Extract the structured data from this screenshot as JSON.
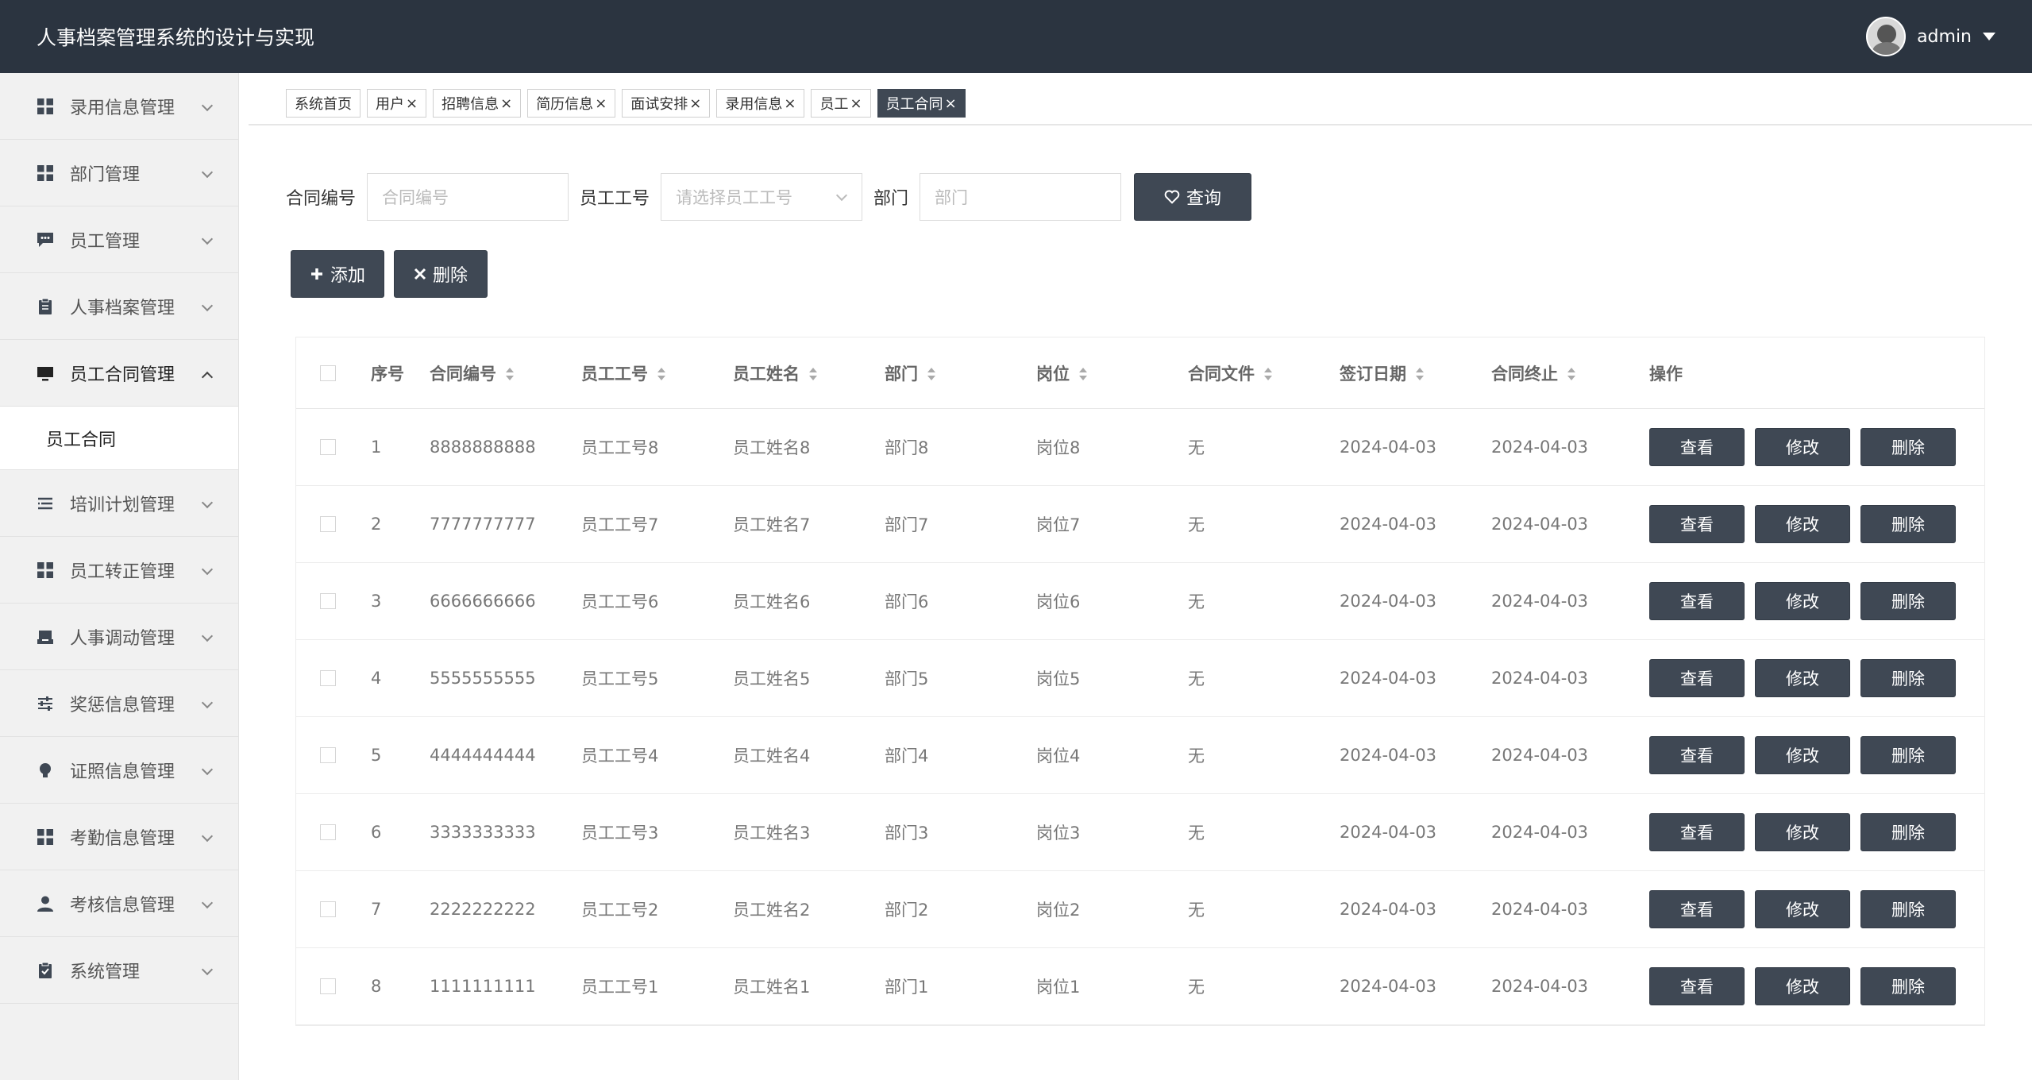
{
  "header": {
    "title": "人事档案管理系统的设计与实现",
    "username": "admin"
  },
  "sidebar": {
    "items": [
      {
        "label": "录用信息管理",
        "icon": "grid-icon"
      },
      {
        "label": "部门管理",
        "icon": "grid-icon"
      },
      {
        "label": "员工管理",
        "icon": "chat-icon"
      },
      {
        "label": "人事档案管理",
        "icon": "clipboard-icon"
      },
      {
        "label": "员工合同管理",
        "icon": "monitor-icon",
        "open": true,
        "children": [
          "员工合同"
        ]
      },
      {
        "label": "培训计划管理",
        "icon": "list-icon"
      },
      {
        "label": "员工转正管理",
        "icon": "grid-icon"
      },
      {
        "label": "人事调动管理",
        "icon": "inbox-icon"
      },
      {
        "label": "奖惩信息管理",
        "icon": "sliders-icon"
      },
      {
        "label": "证照信息管理",
        "icon": "bulb-icon"
      },
      {
        "label": "考勤信息管理",
        "icon": "grid-icon"
      },
      {
        "label": "考核信息管理",
        "icon": "user-icon"
      },
      {
        "label": "系统管理",
        "icon": "clipboard-check-icon"
      }
    ]
  },
  "tabs": [
    {
      "label": "系统首页",
      "closable": false
    },
    {
      "label": "用户",
      "closable": true
    },
    {
      "label": "招聘信息",
      "closable": true
    },
    {
      "label": "简历信息",
      "closable": true
    },
    {
      "label": "面试安排",
      "closable": true
    },
    {
      "label": "录用信息",
      "closable": true
    },
    {
      "label": "员工",
      "closable": true
    },
    {
      "label": "员工合同",
      "closable": true,
      "active": true
    }
  ],
  "search": {
    "contract_no_label": "合同编号",
    "contract_no_placeholder": "合同编号",
    "emp_no_label": "员工工号",
    "emp_no_placeholder": "请选择员工工号",
    "dept_label": "部门",
    "dept_placeholder": "部门",
    "query_button": "查询"
  },
  "actions": {
    "add": "添加",
    "delete": "删除"
  },
  "table": {
    "headers": {
      "index": "序号",
      "contract_no": "合同编号",
      "emp_no": "员工工号",
      "emp_name": "员工姓名",
      "dept": "部门",
      "position": "岗位",
      "file": "合同文件",
      "sign_date": "签订日期",
      "end_date": "合同终止",
      "ops": "操作"
    },
    "op_labels": {
      "view": "查看",
      "edit": "修改",
      "delete": "删除"
    },
    "rows": [
      {
        "index": "1",
        "contract_no": "8888888888",
        "emp_no": "员工工号8",
        "emp_name": "员工姓名8",
        "dept": "部门8",
        "position": "岗位8",
        "file": "无",
        "sign_date": "2024-04-03",
        "end_date": "2024-04-03"
      },
      {
        "index": "2",
        "contract_no": "7777777777",
        "emp_no": "员工工号7",
        "emp_name": "员工姓名7",
        "dept": "部门7",
        "position": "岗位7",
        "file": "无",
        "sign_date": "2024-04-03",
        "end_date": "2024-04-03"
      },
      {
        "index": "3",
        "contract_no": "6666666666",
        "emp_no": "员工工号6",
        "emp_name": "员工姓名6",
        "dept": "部门6",
        "position": "岗位6",
        "file": "无",
        "sign_date": "2024-04-03",
        "end_date": "2024-04-03"
      },
      {
        "index": "4",
        "contract_no": "5555555555",
        "emp_no": "员工工号5",
        "emp_name": "员工姓名5",
        "dept": "部门5",
        "position": "岗位5",
        "file": "无",
        "sign_date": "2024-04-03",
        "end_date": "2024-04-03"
      },
      {
        "index": "5",
        "contract_no": "4444444444",
        "emp_no": "员工工号4",
        "emp_name": "员工姓名4",
        "dept": "部门4",
        "position": "岗位4",
        "file": "无",
        "sign_date": "2024-04-03",
        "end_date": "2024-04-03"
      },
      {
        "index": "6",
        "contract_no": "3333333333",
        "emp_no": "员工工号3",
        "emp_name": "员工姓名3",
        "dept": "部门3",
        "position": "岗位3",
        "file": "无",
        "sign_date": "2024-04-03",
        "end_date": "2024-04-03"
      },
      {
        "index": "7",
        "contract_no": "2222222222",
        "emp_no": "员工工号2",
        "emp_name": "员工姓名2",
        "dept": "部门2",
        "position": "岗位2",
        "file": "无",
        "sign_date": "2024-04-03",
        "end_date": "2024-04-03"
      },
      {
        "index": "8",
        "contract_no": "1111111111",
        "emp_no": "员工工号1",
        "emp_name": "员工姓名1",
        "dept": "部门1",
        "position": "岗位1",
        "file": "无",
        "sign_date": "2024-04-03",
        "end_date": "2024-04-03"
      }
    ]
  },
  "colors": {
    "header_bg": "#2b3440",
    "button_bg": "#3f4854",
    "sidebar_bg": "#f1f1f1"
  }
}
